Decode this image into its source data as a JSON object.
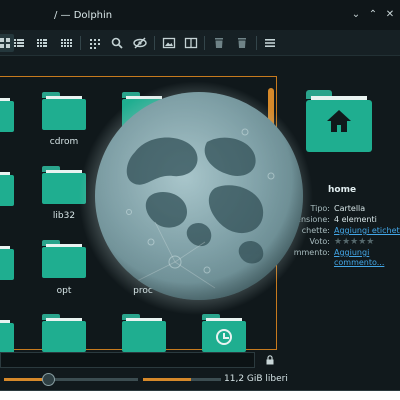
{
  "window": {
    "title": "/ — Dolphin",
    "buttons": {
      "minimize": "⌄",
      "maximize": "⌃",
      "close": "✕"
    }
  },
  "toolbar": {
    "icons": [
      "icons-view-icon",
      "details-view-icon",
      "compact-view-icon",
      "grid-view-icon",
      "select-icon",
      "search-icon",
      "hidden-files-icon",
      "preview-icon",
      "split-view-icon",
      "trash-icon",
      "delete-icon",
      "menu-icon"
    ]
  },
  "files": [
    {
      "name": "",
      "type": "folder"
    },
    {
      "name": "cdrom",
      "type": "folder"
    },
    {
      "name": "",
      "type": "folder"
    },
    {
      "name": "lib32",
      "type": "folder"
    },
    {
      "name": "",
      "type": "folder"
    },
    {
      "name": "opt",
      "type": "folder"
    },
    {
      "name": "proc",
      "type": "folder"
    },
    {
      "name": "",
      "type": "folder"
    },
    {
      "name": "",
      "type": "folder"
    },
    {
      "name": "",
      "type": "folder"
    },
    {
      "name": "",
      "type": "folder-recent"
    }
  ],
  "overlay": {
    "type": "moon-image"
  },
  "info_panel": {
    "name": "home",
    "rows": {
      "type_label": "Tipo:",
      "type_value": "Cartella",
      "size_label": "ensione:",
      "size_value": "4 elementi",
      "tags_label": "chette:",
      "tags_value": "Aggiungi etichette",
      "rating_label": "Voto:",
      "rating_value": "0/5",
      "comment_label": "mmento:",
      "comment_value_1": "Aggiungi",
      "comment_value_2": "commento..."
    },
    "stars": "★★★★★"
  },
  "statusbar": {
    "zoom_fraction": 0.33,
    "space_used_fraction": 0.62,
    "free_space": "11,2 GiB liberi"
  },
  "colors": {
    "accent": "#d6892a",
    "folder": "#1fae90",
    "link": "#43a6e6",
    "background": "#11191c"
  }
}
